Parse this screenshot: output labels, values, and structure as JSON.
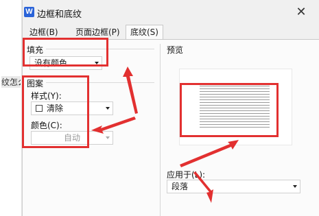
{
  "background": {
    "doc_text": "纹怎么"
  },
  "window": {
    "app_icon_letter": "W",
    "title": "边框和底纹",
    "close_symbol": "✕"
  },
  "tabs": [
    {
      "label": "边框(B)"
    },
    {
      "label": "页面边框(P)"
    },
    {
      "label": "底纹(S)",
      "active": true
    }
  ],
  "fill": {
    "group_label": "填充",
    "color_value": "没有颜色"
  },
  "pattern": {
    "group_label": "图案",
    "style_label": "样式(Y):",
    "style_value": "清除",
    "color_label": "颜色(C):",
    "color_value": "自动",
    "color_disabled": true
  },
  "preview": {
    "group_label": "预览"
  },
  "apply_to": {
    "label": "应用于(L):",
    "value": "段落"
  },
  "colors": {
    "annotation": "#e23030",
    "app_icon": "#2a63d8"
  }
}
